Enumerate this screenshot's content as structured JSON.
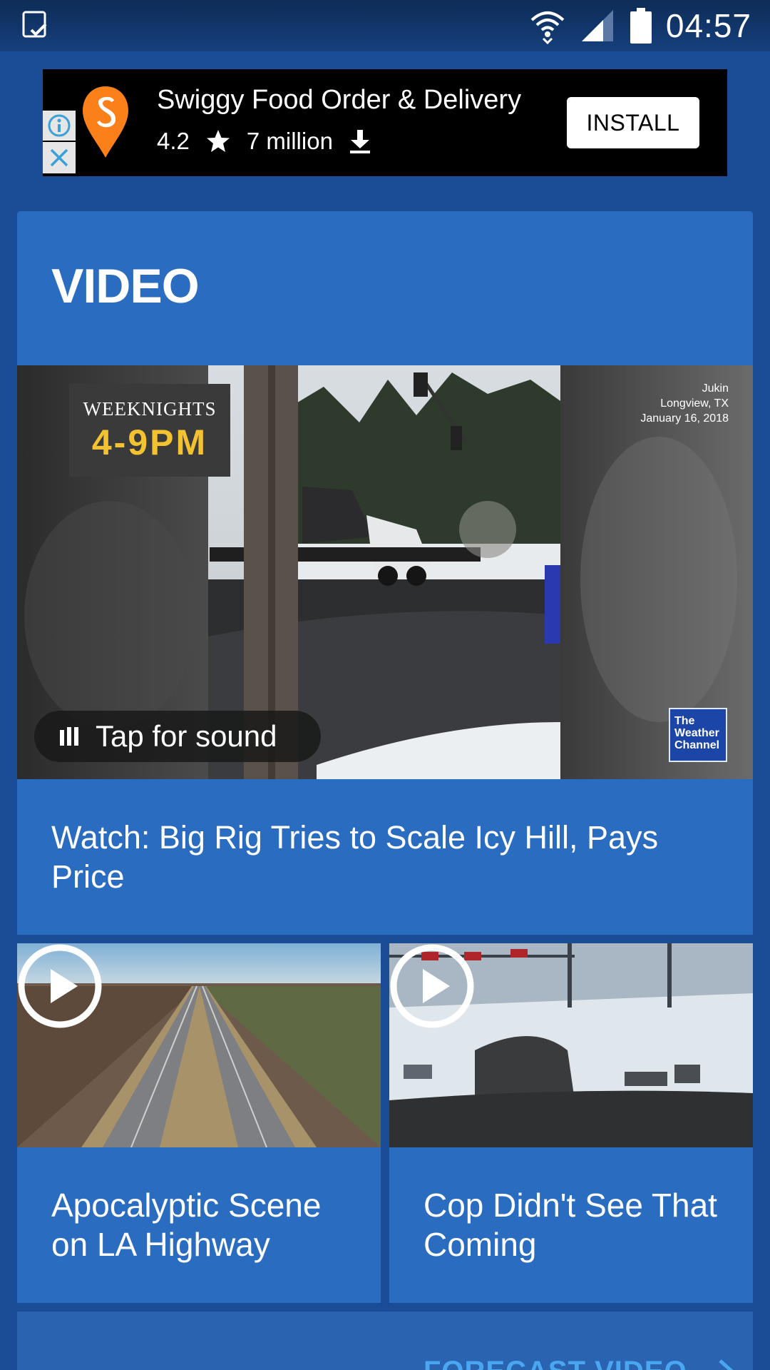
{
  "status_bar": {
    "time": "04:57",
    "icons": [
      "task-check-icon",
      "wifi-icon",
      "signal-icon",
      "battery-icon"
    ]
  },
  "ad": {
    "title": "Swiggy Food Order & Delivery",
    "rating": "4.2",
    "downloads": "7 million",
    "install_label": "INSTALL",
    "brand_color": "#fc8019"
  },
  "video_section": {
    "title": "VIDEO",
    "hero": {
      "promo_line1": "WEEKNIGHTS",
      "promo_line2": "4-9PM",
      "credit": [
        "Jukin",
        "Longview, TX",
        "January 16, 2018"
      ],
      "logo_text": [
        "The",
        "Weather",
        "Channel"
      ],
      "sound_label": "Tap for sound",
      "caption": "Watch: Big Rig Tries to Scale Icy Hill, Pays Price"
    },
    "items": [
      {
        "caption": "Apocalyptic Scene on LA Highway"
      },
      {
        "caption": "Cop Didn't See That Coming"
      }
    ]
  },
  "footer": {
    "link_label": "FORECAST VIDEO"
  },
  "colors": {
    "background": "#1b4d96",
    "card": "#2a6cbf",
    "link": "#4aa6f0"
  }
}
